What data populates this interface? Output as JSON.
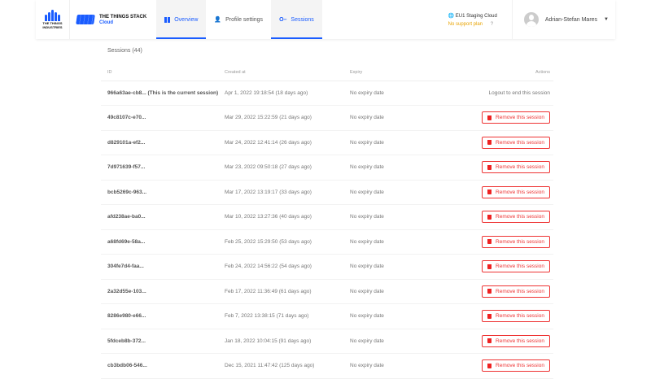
{
  "header": {
    "logo_text": "THE THINGS INDUSTRIES",
    "product_name": "THE THINGS STACK",
    "product_sub": "Cloud",
    "nav": [
      {
        "label": "Overview",
        "icon": "grid-icon",
        "active": true
      },
      {
        "label": "Profile settings",
        "icon": "person-icon",
        "active": false
      },
      {
        "label": "Sessions",
        "icon": "key-icon",
        "active": true
      }
    ],
    "region": "EU1 Staging Cloud",
    "support": "No support plan",
    "user": "Adrian-Stefan Mares",
    "accent": "#1a5cff"
  },
  "main": {
    "title": "Sessions (44)",
    "columns": [
      "ID",
      "Created at",
      "Expiry",
      "Actions"
    ],
    "current_action": "Logout to end this session",
    "remove_label": "Remove this session",
    "rows": [
      {
        "id": "966a63ae-cb8... (This is the current session)",
        "created": "Apr 1, 2022 19:18:54 (18 days ago)",
        "expiry": "No expiry date",
        "current": true
      },
      {
        "id": "49c8107c-e70...",
        "created": "Mar 29, 2022 15:22:59 (21 days ago)",
        "expiry": "No expiry date"
      },
      {
        "id": "d829101a-ef2...",
        "created": "Mar 24, 2022 12:41:14 (26 days ago)",
        "expiry": "No expiry date"
      },
      {
        "id": "7d971639-f57...",
        "created": "Mar 23, 2022 09:50:18 (27 days ago)",
        "expiry": "No expiry date"
      },
      {
        "id": "bcb5269c-963...",
        "created": "Mar 17, 2022 13:19:17 (33 days ago)",
        "expiry": "No expiry date"
      },
      {
        "id": "afd238ae-ba0...",
        "created": "Mar 10, 2022 13:27:36 (40 days ago)",
        "expiry": "No expiry date"
      },
      {
        "id": "a68fd69e-58a...",
        "created": "Feb 25, 2022 15:29:50 (53 days ago)",
        "expiry": "No expiry date"
      },
      {
        "id": "304fe7d4-faa...",
        "created": "Feb 24, 2022 14:56:22 (54 days ago)",
        "expiry": "No expiry date"
      },
      {
        "id": "2a32d55e-103...",
        "created": "Feb 17, 2022 11:36:49 (61 days ago)",
        "expiry": "No expiry date"
      },
      {
        "id": "8286e980-e66...",
        "created": "Feb 7, 2022 13:38:15 (71 days ago)",
        "expiry": "No expiry date"
      },
      {
        "id": "5fdceb8b-372...",
        "created": "Jan 18, 2022 10:04:15 (91 days ago)",
        "expiry": "No expiry date"
      },
      {
        "id": "cb3bdb06-546...",
        "created": "Dec 15, 2021 11:47:42 (125 days ago)",
        "expiry": "No expiry date"
      }
    ]
  }
}
